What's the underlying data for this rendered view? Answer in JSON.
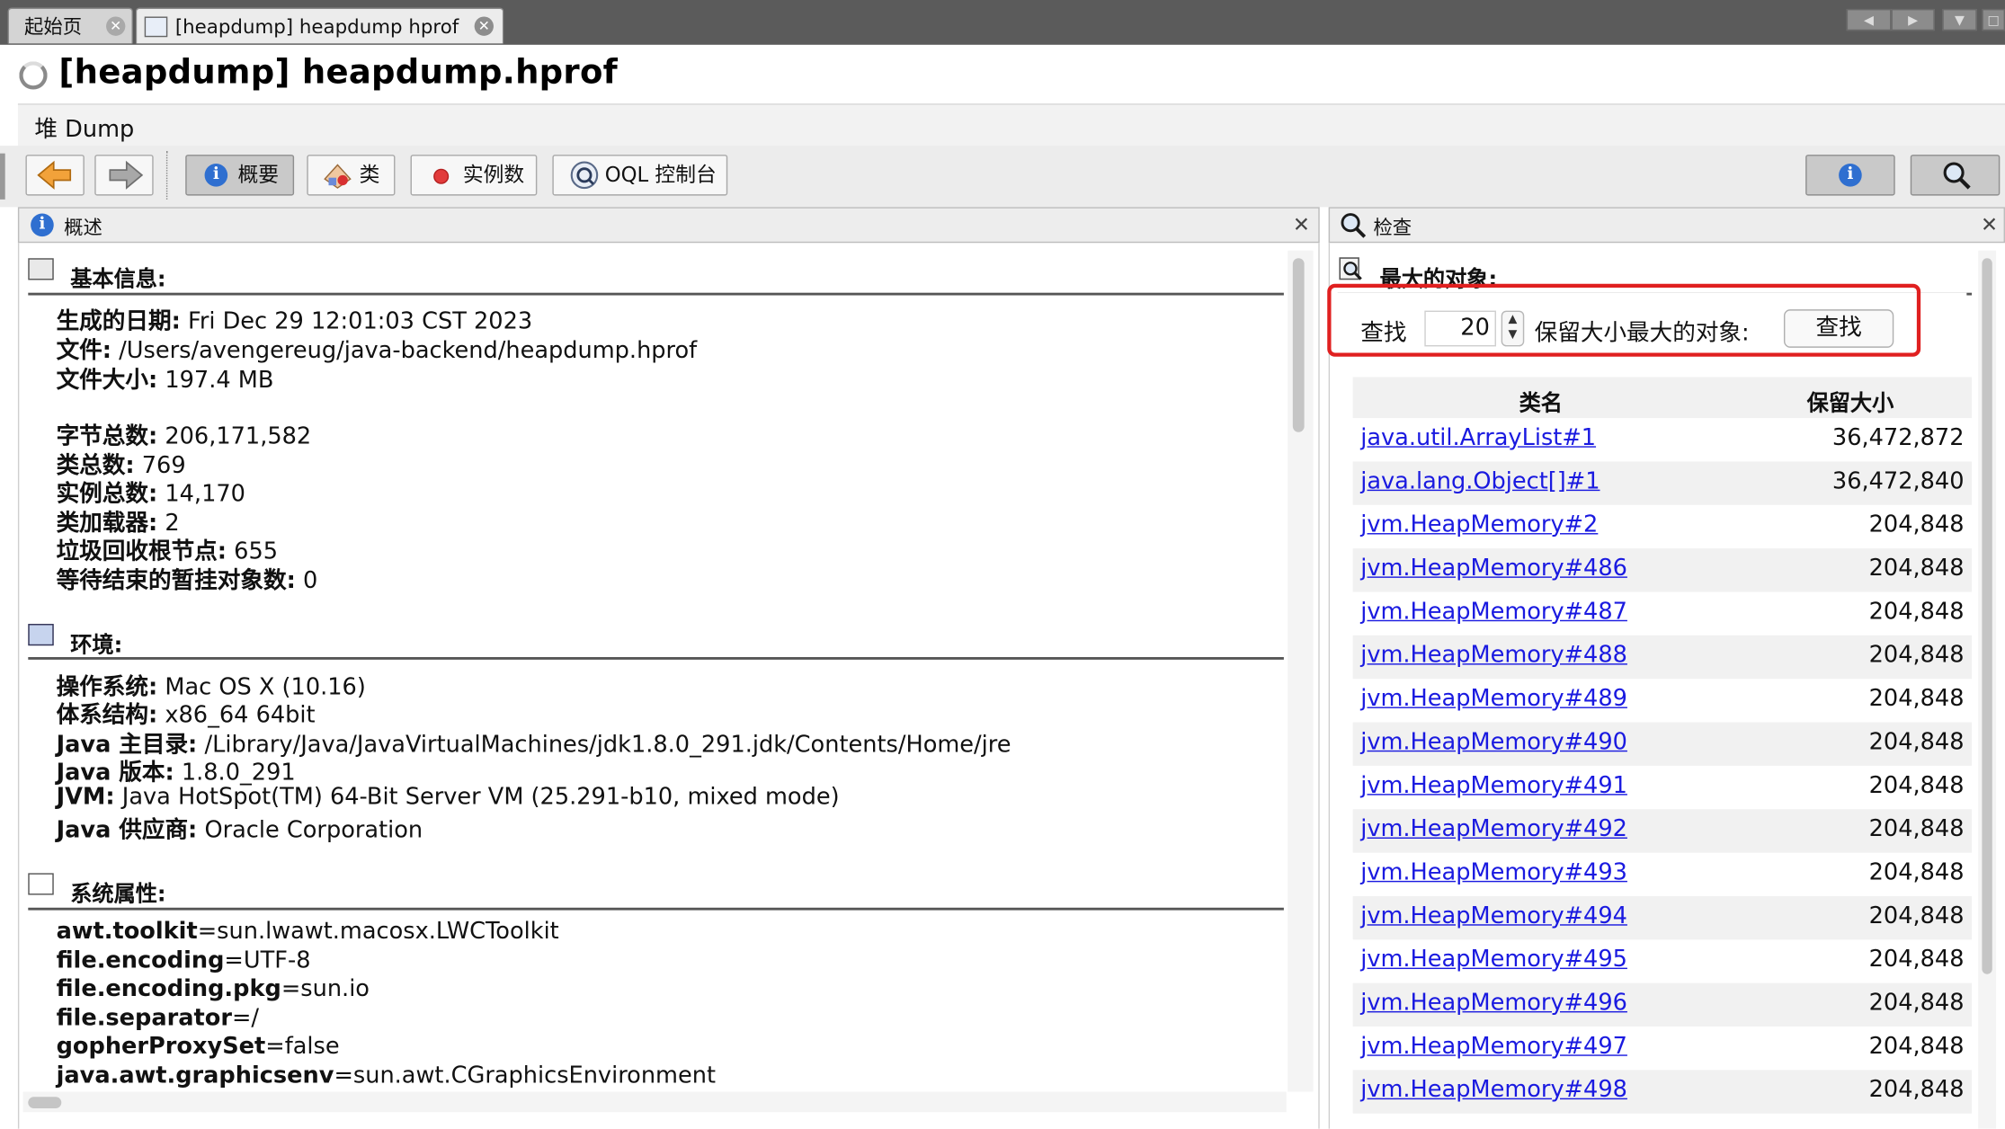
{
  "tabs": [
    {
      "label": "起始页"
    },
    {
      "label": "[heapdump] heapdump hprof"
    }
  ],
  "doc_title": "[heapdump] heapdump.hprof",
  "heap_header": "堆 Dump",
  "toolbar": {
    "summary_label": "概要",
    "classes_label": "类",
    "instances_label": "实例数",
    "oql_label": "OQL 控制台"
  },
  "left_panel": {
    "title": "概述",
    "basic_info": {
      "title": "基本信息:",
      "items": [
        {
          "k": "生成的日期:",
          "v": " Fri Dec 29 12:01:03 CST 2023"
        },
        {
          "k": "文件:",
          "v": " /Users/avengereug/java-backend/heapdump.hprof"
        },
        {
          "k": "文件大小:",
          "v": " 197.4 MB"
        },
        {
          "k": "字节总数:",
          "v": " 206,171,582"
        },
        {
          "k": "类总数:",
          "v": " 769"
        },
        {
          "k": "实例总数:",
          "v": " 14,170"
        },
        {
          "k": "类加载器:",
          "v": " 2"
        },
        {
          "k": "垃圾回收根节点:",
          "v": " 655"
        },
        {
          "k": "等待结束的暂挂对象数:",
          "v": " 0"
        }
      ]
    },
    "environment": {
      "title": "环境:",
      "items": [
        {
          "k": "操作系统:",
          "v": " Mac OS X (10.16)"
        },
        {
          "k": "体系结构:",
          "v": " x86_64 64bit"
        },
        {
          "k": "Java 主目录:",
          "v": " /Library/Java/JavaVirtualMachines/jdk1.8.0_291.jdk/Contents/Home/jre"
        },
        {
          "k": "Java 版本:",
          "v": " 1.8.0_291"
        },
        {
          "k": "JVM:",
          "v": " Java HotSpot(TM) 64-Bit Server VM (25.291-b10, mixed mode)"
        },
        {
          "k": "Java 供应商:",
          "v": " Oracle Corporation"
        }
      ]
    },
    "system_properties": {
      "title": "系统属性:",
      "items": [
        {
          "k": "awt.toolkit",
          "v": "=sun.lwawt.macosx.LWCToolkit"
        },
        {
          "k": "file.encoding",
          "v": "=UTF-8"
        },
        {
          "k": "file.encoding.pkg",
          "v": "=sun.io"
        },
        {
          "k": "file.separator",
          "v": "=/"
        },
        {
          "k": "gopherProxySet",
          "v": "=false"
        },
        {
          "k": "java.awt.graphicsenv",
          "v": "=sun.awt.CGraphicsEnvironment"
        }
      ]
    }
  },
  "right_panel": {
    "title": "检查",
    "section_title": "最大的对象:",
    "find_label": "查找",
    "count_value": "20",
    "suffix_label": "保留大小最大的对象:",
    "find_button": "查找",
    "col_name": "类名",
    "col_size": "保留大小",
    "rows": [
      {
        "name": "java.util.ArrayList#1",
        "size": "36,472,872"
      },
      {
        "name": "java.lang.Object[]#1",
        "size": "36,472,840"
      },
      {
        "name": "jvm.HeapMemory#2",
        "size": "204,848"
      },
      {
        "name": "jvm.HeapMemory#486",
        "size": "204,848"
      },
      {
        "name": "jvm.HeapMemory#487",
        "size": "204,848"
      },
      {
        "name": "jvm.HeapMemory#488",
        "size": "204,848"
      },
      {
        "name": "jvm.HeapMemory#489",
        "size": "204,848"
      },
      {
        "name": "jvm.HeapMemory#490",
        "size": "204,848"
      },
      {
        "name": "jvm.HeapMemory#491",
        "size": "204,848"
      },
      {
        "name": "jvm.HeapMemory#492",
        "size": "204,848"
      },
      {
        "name": "jvm.HeapMemory#493",
        "size": "204,848"
      },
      {
        "name": "jvm.HeapMemory#494",
        "size": "204,848"
      },
      {
        "name": "jvm.HeapMemory#495",
        "size": "204,848"
      },
      {
        "name": "jvm.HeapMemory#496",
        "size": "204,848"
      },
      {
        "name": "jvm.HeapMemory#497",
        "size": "204,848"
      },
      {
        "name": "jvm.HeapMemory#498",
        "size": "204,848"
      }
    ]
  },
  "colors": {
    "link": "#1a1ae0",
    "highlight_box": "#e02020",
    "info_icon": "#2f6fd0"
  }
}
